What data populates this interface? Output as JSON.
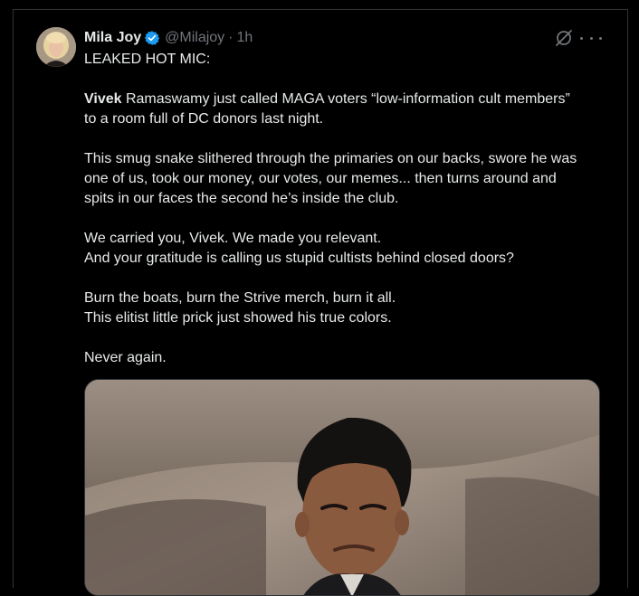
{
  "tweet": {
    "display_name": "Mila Joy",
    "handle": "@Milajoy",
    "separator": "·",
    "timestamp": "1h",
    "verified": true,
    "accent_color": "#1d9bf0",
    "icons": {
      "verified": "verified-badge-icon",
      "grok": "grok-icon",
      "more": "more-options-icon"
    },
    "lines": {
      "l1": "LEAKED HOT MIC:",
      "l2_bold": "Vivek",
      "l2_rest": " Ramaswamy just called MAGA voters “low-information cult members”",
      "l3": "to a room full of DC donors last night.",
      "l4": "This smug snake slithered through the primaries on our backs, swore he was",
      "l5": "one of us, took our money, our votes, our memes... then turns around and",
      "l6": "spits in our faces the second he’s inside the club.",
      "l7": "We carried you, Vivek. We made you relevant.",
      "l8": "And your gratitude is calling us stupid cultists behind closed doors?",
      "l9": "Burn the boats, burn the Strive merch, burn it all.",
      "l10": "This elitist little prick just showed his true colors.",
      "l11": "Never again."
    }
  }
}
